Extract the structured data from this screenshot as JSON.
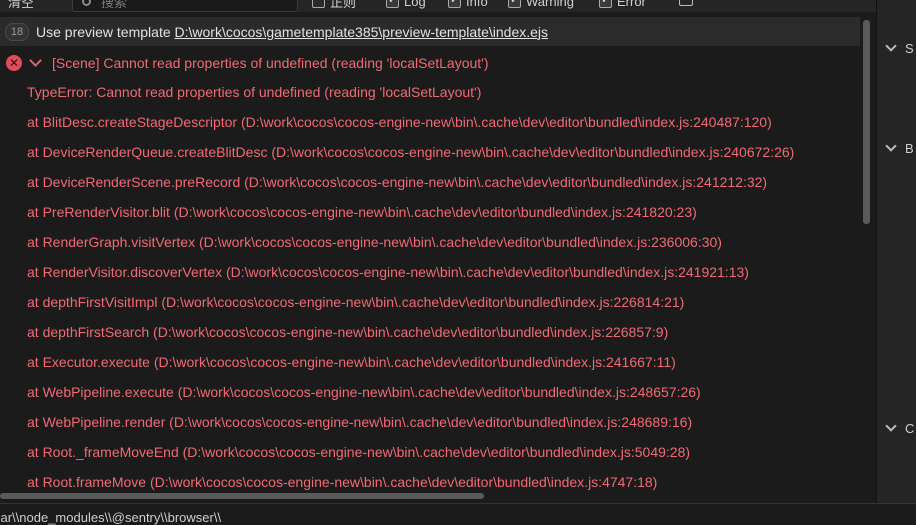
{
  "toolbar": {
    "clear_label": "清空",
    "search_placeholder": "搜索",
    "filters": [
      {
        "label": "正则",
        "checked": false
      },
      {
        "label": "Log",
        "checked": true
      },
      {
        "label": "Info",
        "checked": true
      },
      {
        "label": "Warning",
        "checked": true
      },
      {
        "label": "Error",
        "checked": true
      }
    ]
  },
  "console": {
    "header": {
      "count": "18",
      "prefix": "Use preview template",
      "link": "D:\\work\\cocos\\gametemplate385\\preview-template\\index.ejs"
    },
    "error": {
      "message": "[Scene] Cannot read properties of undefined (reading 'localSetLayout')"
    },
    "trace": [
      "TypeError: Cannot read properties of undefined (reading 'localSetLayout')",
      "at BlitDesc.createStageDescriptor (D:\\work\\cocos\\cocos-engine-new\\bin\\.cache\\dev\\editor\\bundled\\index.js:240487:120)",
      "at DeviceRenderQueue.createBlitDesc (D:\\work\\cocos\\cocos-engine-new\\bin\\.cache\\dev\\editor\\bundled\\index.js:240672:26)",
      "at DeviceRenderScene.preRecord (D:\\work\\cocos\\cocos-engine-new\\bin\\.cache\\dev\\editor\\bundled\\index.js:241212:32)",
      "at PreRenderVisitor.blit (D:\\work\\cocos\\cocos-engine-new\\bin\\.cache\\dev\\editor\\bundled\\index.js:241820:23)",
      "at RenderGraph.visitVertex (D:\\work\\cocos\\cocos-engine-new\\bin\\.cache\\dev\\editor\\bundled\\index.js:236006:30)",
      "at RenderVisitor.discoverVertex (D:\\work\\cocos\\cocos-engine-new\\bin\\.cache\\dev\\editor\\bundled\\index.js:241921:13)",
      "at depthFirstVisitImpl (D:\\work\\cocos\\cocos-engine-new\\bin\\.cache\\dev\\editor\\bundled\\index.js:226814:21)",
      "at depthFirstSearch (D:\\work\\cocos\\cocos-engine-new\\bin\\.cache\\dev\\editor\\bundled\\index.js:226857:9)",
      "at Executor.execute (D:\\work\\cocos\\cocos-engine-new\\bin\\.cache\\dev\\editor\\bundled\\index.js:241667:11)",
      "at WebPipeline.execute (D:\\work\\cocos\\cocos-engine-new\\bin\\.cache\\dev\\editor\\bundled\\index.js:248657:26)",
      "at WebPipeline.render (D:\\work\\cocos\\cocos-engine-new\\bin\\.cache\\dev\\editor\\bundled\\index.js:248689:16)",
      "at Root._frameMoveEnd (D:\\work\\cocos\\cocos-engine-new\\bin\\.cache\\dev\\editor\\bundled\\index.js:5049:28)",
      "at Root.frameMove (D:\\work\\cocos\\cocos-engine-new\\bin\\.cache\\dev\\editor\\bundled\\index.js:4747:18)"
    ]
  },
  "right_panel": {
    "sections": [
      "S",
      "B",
      "C"
    ]
  },
  "status": {
    "text": "sar\\\\node_modules\\\\@sentry\\\\browser\\\\"
  },
  "colors": {
    "error": "#f06a74",
    "background": "#1b1b1b"
  }
}
